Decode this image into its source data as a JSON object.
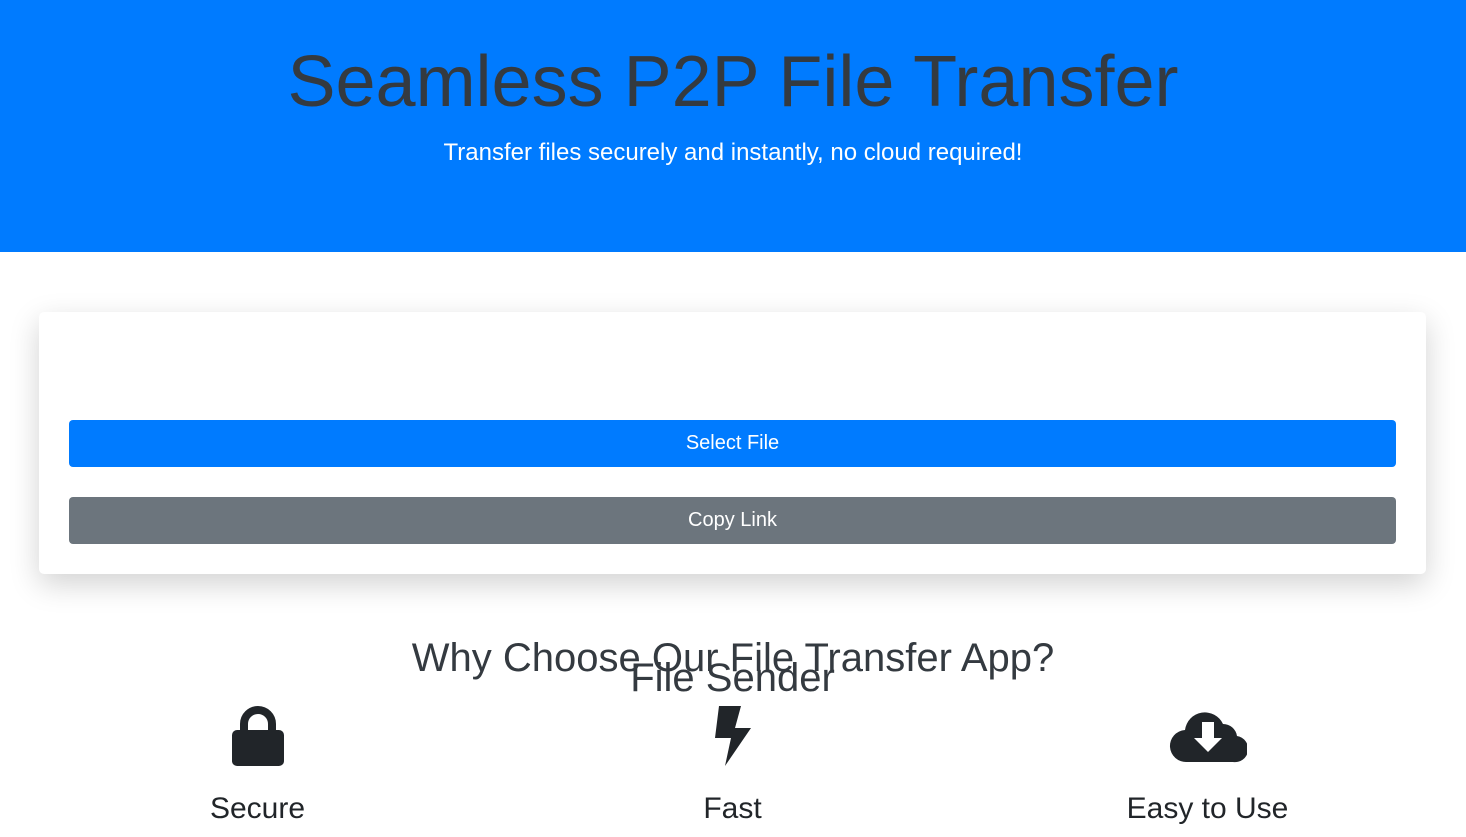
{
  "hero": {
    "title": "Seamless P2P File Transfer",
    "subtitle": "Transfer files securely and instantly, no cloud required!",
    "background_color": "#007bff"
  },
  "sender_card": {
    "title": "File Sender",
    "select_button_label": "Select File",
    "copy_button_label": "Copy Link",
    "primary_color": "#007bff",
    "secondary_color": "#6c757d"
  },
  "features": {
    "title": "Why Choose Our File Transfer App?",
    "items": [
      {
        "icon": "lock-icon",
        "label": "Secure"
      },
      {
        "icon": "bolt-icon",
        "label": "Fast"
      },
      {
        "icon": "cloud-download-icon",
        "label": "Easy to Use"
      }
    ]
  }
}
